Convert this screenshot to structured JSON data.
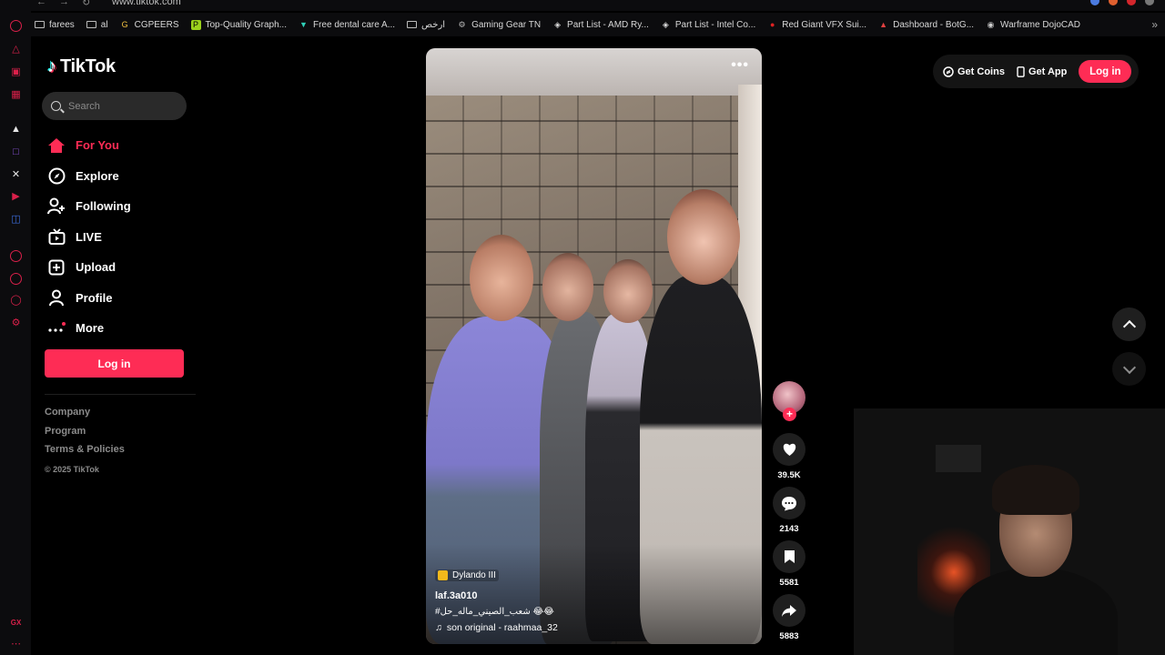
{
  "browser": {
    "url": "www.tiktok.com",
    "bookmarks": [
      {
        "label": "farees",
        "icon": "folder-icon"
      },
      {
        "label": "al",
        "icon": "folder-icon"
      },
      {
        "label": "CGPEERS",
        "icon": "cgpeers-icon"
      },
      {
        "label": "Top-Quality Graph...",
        "icon": "green-square-icon"
      },
      {
        "label": "Free dental care A...",
        "icon": "teal-triangle-icon"
      },
      {
        "label": "ارخص",
        "icon": "folder-icon"
      },
      {
        "label": "Gaming Gear TN",
        "icon": "gear-logo-icon"
      },
      {
        "label": "Part List - AMD Ry...",
        "icon": "pcpartpicker-icon"
      },
      {
        "label": "Part List - Intel Co...",
        "icon": "pcpartpicker-icon"
      },
      {
        "label": "Red Giant VFX Sui...",
        "icon": "redgiant-icon"
      },
      {
        "label": "Dashboard - BotG...",
        "icon": "botg-icon"
      },
      {
        "label": "Warframe DojoCAD",
        "icon": "warframe-icon"
      }
    ]
  },
  "sidebar": {
    "logo_text": "TikTok",
    "search_placeholder": "Search",
    "nav": [
      {
        "label": "For You",
        "icon": "home-icon",
        "active": true
      },
      {
        "label": "Explore",
        "icon": "compass-icon"
      },
      {
        "label": "Following",
        "icon": "user-plus-icon"
      },
      {
        "label": "LIVE",
        "icon": "live-tv-icon"
      },
      {
        "label": "Upload",
        "icon": "plus-square-icon"
      },
      {
        "label": "Profile",
        "icon": "person-icon"
      },
      {
        "label": "More",
        "icon": "more-dots-icon"
      }
    ],
    "login_label": "Log in",
    "footer_links": [
      "Company",
      "Program",
      "Terms & Policies"
    ],
    "copyright": "© 2025 TikTok"
  },
  "video": {
    "tag": "Dylando III",
    "username": "laf.3a010",
    "caption": "#شعب_الصيني_ماله_حل 😂😂",
    "sound": "son original - raahmaa_32"
  },
  "actions": {
    "likes": "39.5K",
    "comments": "2143",
    "saves": "5581",
    "shares": "5883"
  },
  "topright": {
    "coins_label": "Get Coins",
    "app_label": "Get App",
    "login_label": "Log in"
  },
  "colors": {
    "accent": "#fe2c55",
    "background": "#000000",
    "panel": "#1f1f1f"
  }
}
